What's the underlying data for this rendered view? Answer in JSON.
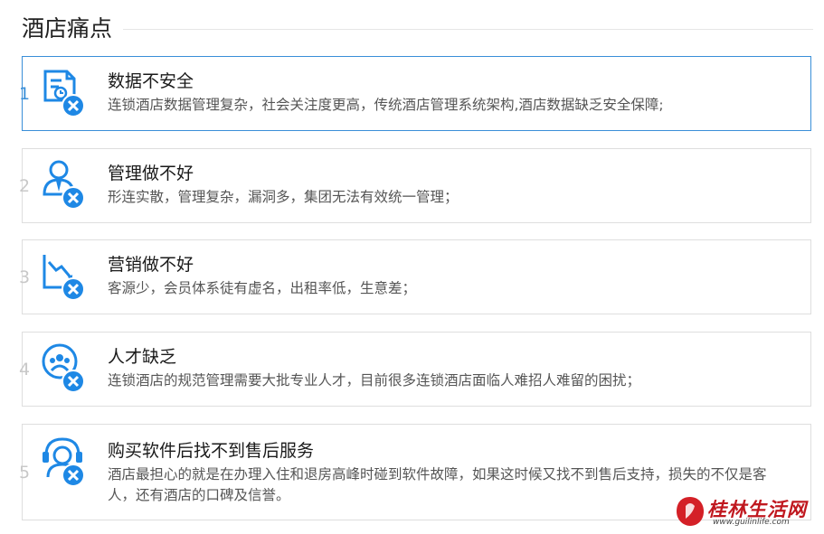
{
  "section": {
    "title": "酒店痛点"
  },
  "items": [
    {
      "num": "1",
      "title": "数据不安全",
      "desc": "连锁酒店数据管理复杂，社会关注度更高，传统酒店管理系统架构,酒店数据缺乏安全保障;",
      "icon": "data-security-icon"
    },
    {
      "num": "2",
      "title": "管理做不好",
      "desc": "形连实散，管理复杂，漏洞多，集团无法有效统一管理；",
      "icon": "staff-management-icon"
    },
    {
      "num": "3",
      "title": "营销做不好",
      "desc": "客源少，会员体系徒有虚名，出租率低，生意差；",
      "icon": "declining-chart-icon"
    },
    {
      "num": "4",
      "title": "人才缺乏",
      "desc": "连锁酒店的规范管理需要大批专业人才，目前很多连锁酒店面临人难招人难留的困扰；",
      "icon": "talent-team-icon"
    },
    {
      "num": "5",
      "title": "购买软件后找不到售后服务",
      "desc": "酒店最担心的就是在办理入住和退房高峰时碰到软件故障，如果这时候又找不到售后支持，损失的不仅是客人，还有酒店的口碑及信誉。",
      "icon": "customer-support-icon"
    }
  ],
  "watermark": {
    "text": "桂林生活网",
    "sub": "www.guilinlife.com"
  },
  "colors": {
    "accent": "#3a8fd8",
    "icon_blue": "#1e88e5",
    "border": "#dedede"
  }
}
